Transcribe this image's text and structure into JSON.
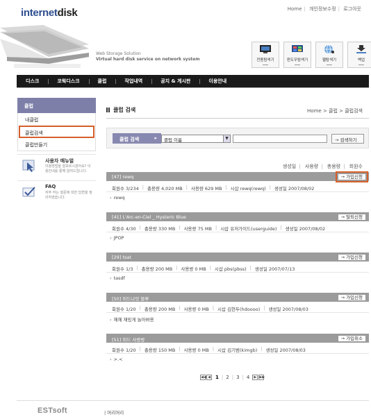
{
  "header": {
    "logo_a": "internet",
    "logo_b": "disk",
    "links": [
      "Home",
      "개인정보수정",
      "로그아웃"
    ],
    "tagline_1": "Web Storage Solution",
    "tagline_2": "Virtual hard disk service on network system"
  },
  "tools": [
    {
      "label": "전용탐색기",
      "icon": "folder-explorer-icon"
    },
    {
      "label": "윈도우탐색기",
      "icon": "windows-explorer-icon"
    },
    {
      "label": "웹탐색기",
      "icon": "web-explorer-icon"
    },
    {
      "label": "백업",
      "icon": "backup-download-icon"
    }
  ],
  "nav": [
    "디스크",
    "코웍디스크",
    "클럽",
    "작업내역",
    "공지 & 게시판",
    "이용안내"
  ],
  "sidebar": {
    "title": "클럽",
    "items": [
      "내클럽",
      "클럽검색",
      "클럽만들기"
    ],
    "active_index": 1,
    "manual": {
      "title": "사용자 매뉴얼",
      "desc": "이용방법을 잘모르시겠어요? 이용안내를 통해 알려드립니다."
    },
    "faq": {
      "title": "FAQ",
      "desc": "자주 하는 질문에 대한 답변을 정리하였습니다."
    }
  },
  "main": {
    "title": "클럽 검색",
    "breadcrumb": "Home > 클럽 > 클럽검색"
  },
  "search": {
    "label": "클럽 검색",
    "arrow": "▸",
    "select_value": "클럽 이름",
    "button": "→ 검색하기"
  },
  "sort": [
    "생성일",
    "사용량",
    "총용량",
    "회원수"
  ],
  "clubs": [
    {
      "name": "[47] rewq",
      "btn": "→ 가입신청",
      "members": "회원수  3/234",
      "total": "총용량  4,020 MB",
      "used": "사용량  629 MB",
      "owner": "시삽  rewq(rewq)",
      "created": "생성일  2007/08/02",
      "desc": "rewq"
    },
    {
      "name": "[41] L'Arc-en-Ciel _ Hysteric Blue",
      "btn": "→ 탈퇴신청",
      "members": "회원수  4/30",
      "total": "총용량  330 MB",
      "used": "사용량  75 MB",
      "owner": "시삽  유저가이드(userguide)",
      "created": "생성일  2007/08/02",
      "desc": "JPOP"
    },
    {
      "name": "[29] tsat",
      "btn": "→ 가입신청",
      "members": "회원수  1/3",
      "total": "총용량  200 MB",
      "used": "사용량  0 MB",
      "owner": "시삽  pbs(pbss)",
      "created": "생성일  2007/07/13",
      "desc": "tasdf"
    },
    {
      "name": "[50] 미드나잇 블루",
      "btn": "→ 가입신청",
      "members": "회원수  1/20",
      "total": "총용량  200 MB",
      "used": "사용량  0 MB",
      "owner": "시삽  김현두(hdoooo)",
      "created": "생성일  2007/08/03",
      "desc": "헤헤 재밌게 놀아봐용"
    },
    {
      "name": "[51] 미드 사랑방",
      "btn": "→ 가입취소",
      "members": "회원수  1/20",
      "total": "총용량  150 MB",
      "used": "사용량  0 MB",
      "owner": "시삽  김기범(kimgb)",
      "created": "생성일  2007/08/03",
      "desc": ">.<"
    }
  ],
  "pager": {
    "pages": [
      "1",
      "2",
      "3",
      "4"
    ],
    "current": "1",
    "first": "◀◀",
    "prev": "◀",
    "next": "▶",
    "last": "▶▶"
  },
  "footer": {
    "logo": "ESTsoft",
    "link": "| 머리머리"
  },
  "colors": {
    "accent": "#7e7fa8",
    "highlight": "#d55f2a",
    "nav_bg": "#1a1a1a",
    "club_bar": "#9b9b9b"
  }
}
